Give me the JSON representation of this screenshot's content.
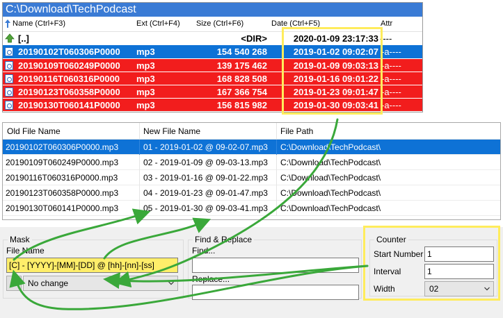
{
  "file_panel": {
    "path": "C:\\Download\\TechPodcast",
    "columns": {
      "name": "Name (Ctrl+F3)",
      "ext": "Ext (Ctrl+F4)",
      "size": "Size (Ctrl+F6)",
      "date": "Date (Ctrl+F5)",
      "attr": "Attr"
    },
    "up_row": {
      "name": "[..]",
      "size": "<DIR>",
      "date": "2020-01-09 23:17:33",
      "attr": "----"
    },
    "files": [
      {
        "name": "20190102T060306P0000",
        "ext": "mp3",
        "size": "154 540 268",
        "date": "2019-01-02 09:02:07",
        "attr": "-a----"
      },
      {
        "name": "20190109T060249P0000",
        "ext": "mp3",
        "size": "139 175 462",
        "date": "2019-01-09 09:03:13",
        "attr": "-a----"
      },
      {
        "name": "20190116T060316P0000",
        "ext": "mp3",
        "size": "168 828 508",
        "date": "2019-01-16 09:01:22",
        "attr": "-a----"
      },
      {
        "name": "20190123T060358P0000",
        "ext": "mp3",
        "size": "167 366 754",
        "date": "2019-01-23 09:01:47",
        "attr": "-a----"
      },
      {
        "name": "20190130T060141P0000",
        "ext": "mp3",
        "size": "156 815 982",
        "date": "2019-01-30 09:03:41",
        "attr": "-a----"
      }
    ]
  },
  "rename_list": {
    "headers": {
      "old": "Old File Name",
      "new": "New File Name",
      "path": "File Path"
    },
    "rows": [
      {
        "old": "20190102T060306P0000.mp3",
        "new": "01 - 2019-01-02 @ 09-02-07.mp3",
        "path": "C:\\Download\\TechPodcast\\"
      },
      {
        "old": "20190109T060249P0000.mp3",
        "new": "02 - 2019-01-09 @ 09-03-13.mp3",
        "path": "C:\\Download\\TechPodcast\\"
      },
      {
        "old": "20190116T060316P0000.mp3",
        "new": "03 - 2019-01-16 @ 09-01-22.mp3",
        "path": "C:\\Download\\TechPodcast\\"
      },
      {
        "old": "20190123T060358P0000.mp3",
        "new": "04 - 2019-01-23 @ 09-01-47.mp3",
        "path": "C:\\Download\\TechPodcast\\"
      },
      {
        "old": "20190130T060141P0000.mp3",
        "new": "05 - 2019-01-30 @ 09-03-41.mp3",
        "path": "C:\\Download\\TechPodcast\\"
      }
    ]
  },
  "mask": {
    "title": "Mask",
    "file_name_label": "File Name",
    "file_name_value": "[C] - [YYYY]-[MM]-[DD] @ [hh]-[nn]-[ss]",
    "case_option": "No change"
  },
  "find_replace": {
    "title": "Find & Replace",
    "find_label": "Find...",
    "replace_label": "Replace...",
    "find_value": "",
    "replace_value": ""
  },
  "counter": {
    "title": "Counter",
    "start_label": "Start Number",
    "start_value": "1",
    "interval_label": "Interval",
    "interval_value": "1",
    "width_label": "Width",
    "width_value": "02"
  },
  "colors": {
    "selection": "#0e72d6",
    "marked": "#f21d1d",
    "highlight": "#ffec5c",
    "arrow": "#3aa83a"
  }
}
